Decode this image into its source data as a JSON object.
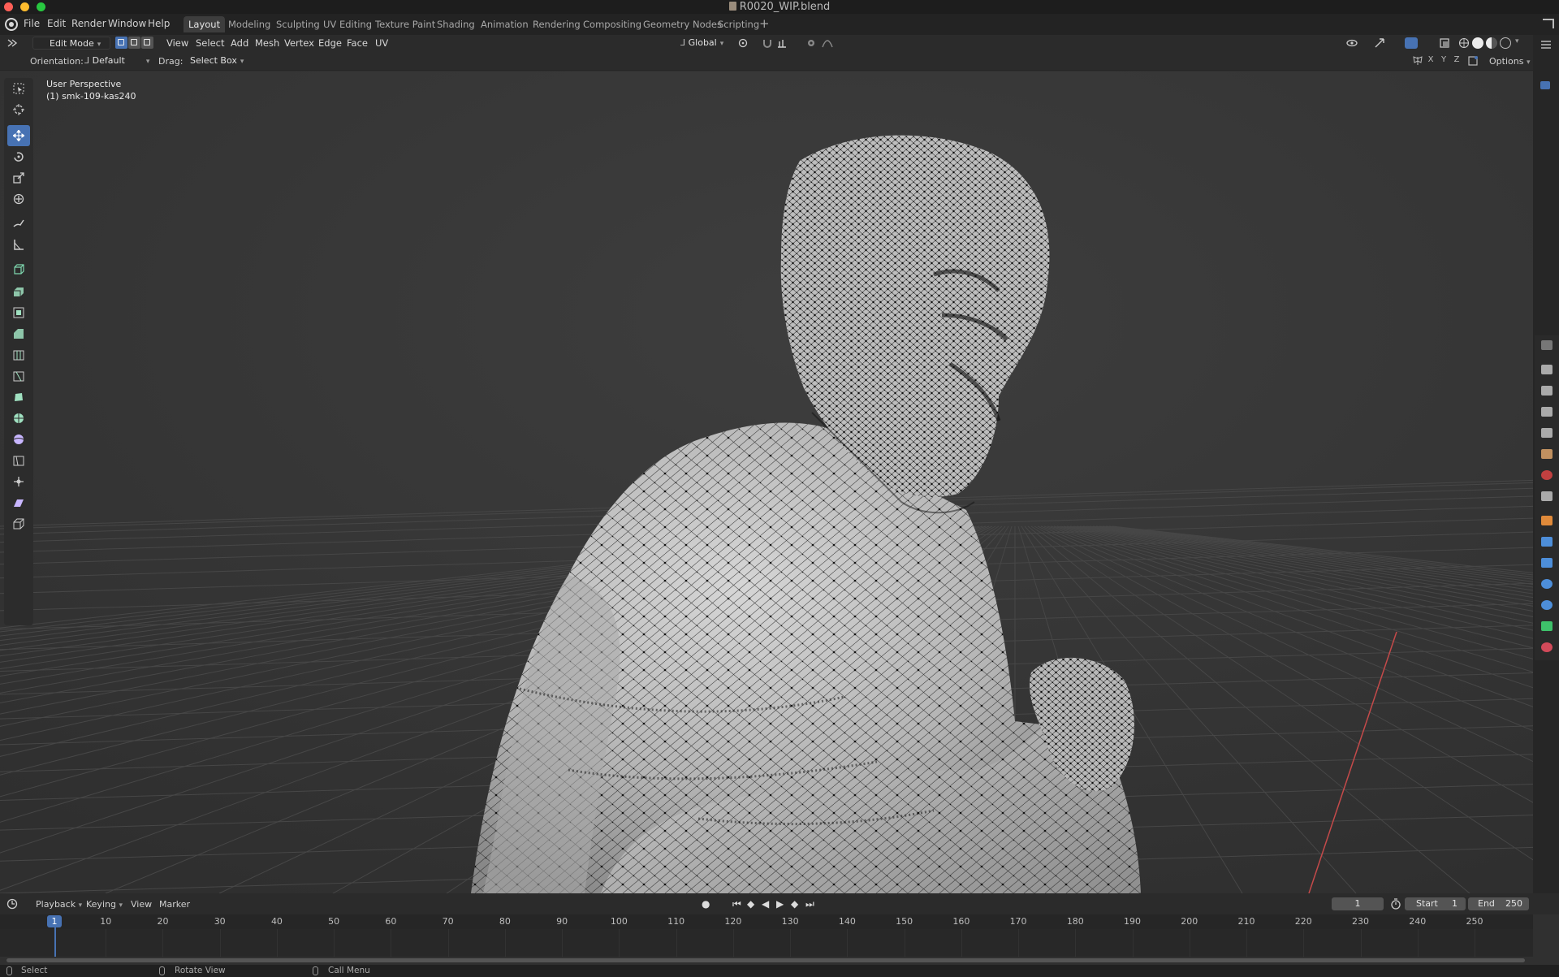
{
  "window": {
    "title": "R0020_WIP.blend"
  },
  "menu": [
    "File",
    "Edit",
    "Render",
    "Window",
    "Help"
  ],
  "workspaces": [
    "Layout",
    "Modeling",
    "Sculpting",
    "UV Editing",
    "Texture Paint",
    "Shading",
    "Animation",
    "Rendering",
    "Compositing",
    "Geometry Nodes",
    "Scripting"
  ],
  "active_workspace": "Layout",
  "header": {
    "mode": "Edit Mode",
    "menus": [
      "View",
      "Select",
      "Add",
      "Mesh",
      "Vertex",
      "Edge",
      "Face",
      "UV"
    ],
    "transform_orientation": "Global",
    "select_mode_active": "vertex"
  },
  "tool_settings": {
    "orientation_label": "Orientation:",
    "orientation_value": "Default",
    "drag_label": "Drag:",
    "drag_value": "Select Box",
    "axes": [
      "X",
      "Y",
      "Z"
    ],
    "options_label": "Options"
  },
  "viewport": {
    "view_name": "User Perspective",
    "object_name": "(1) smk-109-kas240",
    "shading_mode": "solid",
    "colors": {
      "background": "#3a3a3a",
      "grid": "#474747",
      "x_axis": "#c44a4a",
      "mesh": "#b8b8b8",
      "wire": "#141414"
    }
  },
  "toolbar": {
    "active_tool": "move",
    "tools": [
      "select-box",
      "cursor",
      "move",
      "rotate",
      "scale",
      "transform",
      "annotate",
      "measure",
      "add-cube",
      "extrude-region",
      "inset-faces",
      "bevel",
      "loop-cut",
      "knife",
      "poly-build",
      "spin",
      "smooth",
      "edge-slide",
      "shrink-fatten",
      "shear",
      "rip-region"
    ]
  },
  "timeline": {
    "menus": [
      "Playback",
      "Keying",
      "View",
      "Marker"
    ],
    "current_frame": "1",
    "start_label": "Start",
    "start_value": "1",
    "end_label": "End",
    "end_value": "250",
    "ruler": [
      "10",
      "20",
      "30",
      "40",
      "50",
      "60",
      "70",
      "80",
      "90",
      "100",
      "110",
      "120",
      "130",
      "140",
      "150",
      "160",
      "170",
      "180",
      "190",
      "200",
      "210",
      "220",
      "230",
      "240",
      "250"
    ]
  },
  "statusbar": [
    "Select",
    "Rotate View",
    "Call Menu"
  ],
  "accent": "#4772b3"
}
